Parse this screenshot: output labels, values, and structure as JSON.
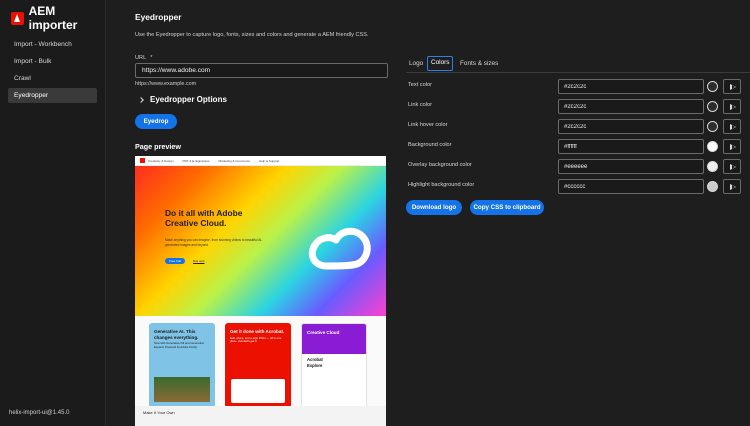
{
  "app": {
    "title": "AEM importer",
    "version": "helix-import-ui@1.45.0"
  },
  "sidebar": {
    "items": [
      {
        "label": "Import - Workbench",
        "active": false
      },
      {
        "label": "Import - Bulk",
        "active": false
      },
      {
        "label": "Crawl",
        "active": false
      },
      {
        "label": "Eyedropper",
        "active": true
      }
    ]
  },
  "page": {
    "title": "Eyedropper",
    "description": "Use the Eyedropper to capture logo, fonts, sizes and colors and generate a AEM friendly CSS."
  },
  "url_field": {
    "label": "URL",
    "required_mark": "*",
    "value": "https://www.adobe.com",
    "help": "https://www.example.com"
  },
  "options": {
    "label": "Eyedropper Options"
  },
  "buttons": {
    "eyedrop": "Eyedrop",
    "download_logo": "Download logo",
    "copy_css": "Copy CSS to clipboard"
  },
  "preview": {
    "title": "Page preview",
    "nav_items": [
      "Creativity & Design",
      "PDF & E-Signatures",
      "Marketing & Commerce",
      "Help & Support"
    ],
    "hero_title": "Do it all with Adobe Creative Cloud.",
    "hero_text": "Make anything you can imagine, from stunning videos to beautiful AI-generated images and beyond.",
    "hero_button": "Free trial",
    "hero_link": "Buy now",
    "cards": [
      {
        "title": "Generative AI. This changes everything.",
        "text": "Now with Generative Fill and Generative Expand. Powered by Adobe Firefly."
      },
      {
        "title": "Get it done with Acrobat.",
        "text": "Edit, share, and e-sign PDFs — all in one place. Acrobat's got it."
      },
      {
        "title": "Creative Cloud",
        "text": "Acrobat",
        "sub": "Explore"
      }
    ],
    "footer": "Make It Your Own"
  },
  "tabs": [
    {
      "label": "Logo",
      "active": false
    },
    {
      "label": "Colors",
      "active": true
    },
    {
      "label": "Fonts & sizes",
      "active": false
    }
  ],
  "colors": [
    {
      "label": "Text color",
      "value": "#2c2c2c",
      "swatch": "#2c2c2c"
    },
    {
      "label": "Link color",
      "value": "#2c2c2c",
      "swatch": "#2c2c2c"
    },
    {
      "label": "Link hover color",
      "value": "#2c2c2c",
      "swatch": "#2c2c2c"
    },
    {
      "label": "Background color",
      "value": "#ffffff",
      "swatch": "#ffffff"
    },
    {
      "label": "Overlay background color",
      "value": "#eeeeee",
      "swatch": "#eeeeee"
    },
    {
      "label": "Highlight background color",
      "value": "#cccccc",
      "swatch": "#cccccc"
    }
  ],
  "theme": {
    "accent": "#1473e6",
    "brand": "#eb1000"
  }
}
